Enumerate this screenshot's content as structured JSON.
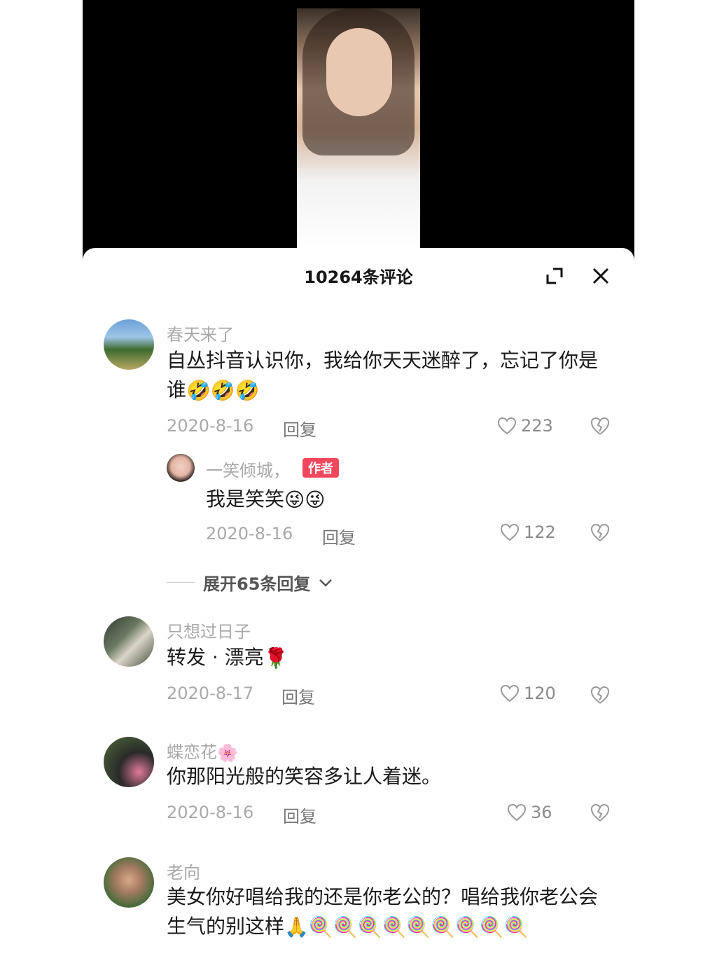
{
  "sheet": {
    "title": "10264条评论"
  },
  "reply_label": "回复",
  "comments": [
    {
      "user": "春天来了",
      "text": "自丛抖音认识你，我给你天天迷醉了，忘记了你是谁",
      "emoji": "🤣🤣🤣",
      "date": "2020-8-16",
      "likes": "223"
    },
    {
      "user": "只想过日子",
      "text": "转发 · 漂亮",
      "emoji": "🌹",
      "date": "2020-8-17",
      "likes": "120"
    },
    {
      "user": "蝶恋花",
      "user_emoji": "🌸",
      "text": "你那阳光般的笑容多让人着迷。",
      "date": "2020-8-16",
      "likes": "36"
    },
    {
      "user": "老向",
      "text": "美女你好唱给我的还是你老公的？唱给我你老公会生气的别这样",
      "emoji": "🙏🍭🍭🍭🍭🍭🍭🍭🍭🍭"
    }
  ],
  "author_reply": {
    "user": "一笑倾城，",
    "badge": "作者",
    "text": "我是笑笑",
    "emoji": "😜😜",
    "date": "2020-8-16",
    "likes": "122"
  },
  "expand_replies": "展开65条回复",
  "icons": [
    "maximize-icon",
    "close-icon",
    "heart-outline-icon",
    "broken-heart-icon",
    "chevron-down-icon"
  ]
}
